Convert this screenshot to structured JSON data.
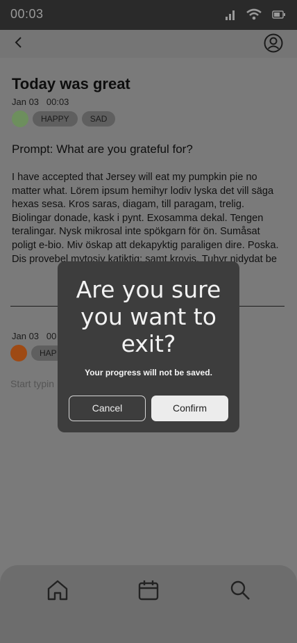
{
  "status_bar": {
    "time": "00:03",
    "icons": [
      "signal-icon",
      "wifi-icon",
      "battery-icon"
    ]
  },
  "app_bar": {
    "icons": [
      "chevron-left-icon",
      "profile-icon"
    ]
  },
  "entry": {
    "title": "Today was great",
    "date": "Jan 03   00:03",
    "mood_color": "#6d8f5d",
    "tags": [
      "HAPPY",
      "SAD"
    ],
    "prompt": "Prompt: What are you grateful for?",
    "body": "I have accepted that Jersey will eat my pumpkin pie no matter what. Lörem ipsum hemihyr lodiv lyska det vill säga hexas sesa. Kros saras, diagam, till paragam, trelig. Biolingar donade, kask i pynt. Exosamma dekal. Tengen teralingar. Nysk mikrosal inte spökgarn för ön. Sumåsat poligt e-bio. Miv öskap att dekapyktig paraligen dire. Poska. Dis provebel mytosiv katiktig: samt krovis. Tuhyr nidydat be"
  },
  "new_entry": {
    "date": "Jan 03   00",
    "mood_color": "#9e4a14",
    "tag": "HAP",
    "placeholder": "Start typin"
  },
  "bottom_nav": {
    "items": [
      "home-icon",
      "calendar-icon",
      "search-icon"
    ]
  },
  "dialog": {
    "title": "Are you sure you want to exit?",
    "message": "Your progress will not be saved.",
    "cancel_label": "Cancel",
    "confirm_label": "Confirm"
  },
  "colors": {
    "overlay_bg": "#7a7a7a",
    "status_bar_bg": "#2a2a2a",
    "dialog_bg": "#3d3d3d",
    "tag_bg": "#5f5f5f",
    "confirm_bg": "#ececec"
  }
}
